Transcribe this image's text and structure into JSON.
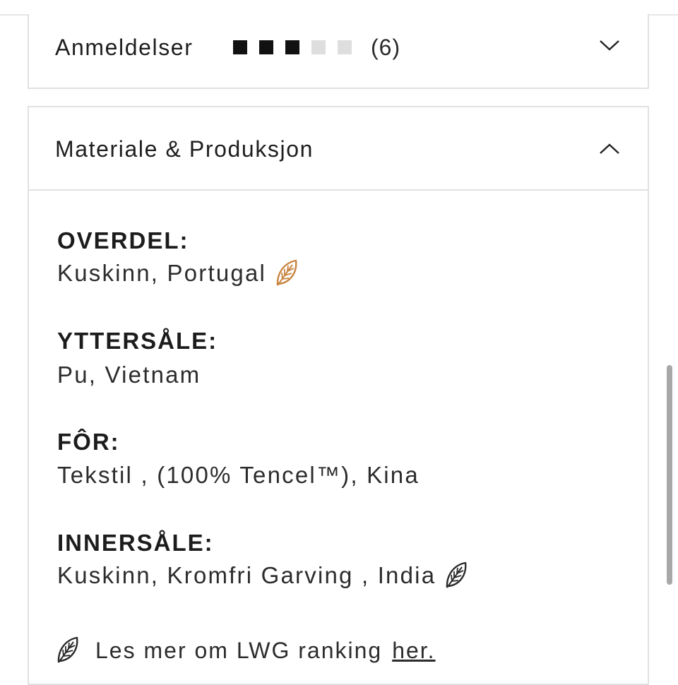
{
  "reviews": {
    "title": "Anmeldelser",
    "rating": 3,
    "rating_max": 5,
    "count": "(6)",
    "expanded": false
  },
  "materials": {
    "title": "Materiale & Produksjon",
    "expanded": true,
    "items": [
      {
        "label": "OVERDEL:",
        "value": "Kuskinn, Portugal",
        "leaf": "leaf-icon-orange"
      },
      {
        "label": "YTTERSÅLE:",
        "value": "Pu, Vietnam",
        "leaf": ""
      },
      {
        "label": "FÔR:",
        "value": "Tekstil , (100% Tencel™), Kina",
        "leaf": ""
      },
      {
        "label": "INNERSÅLE:",
        "value": "Kuskinn, Kromfri Garving , India",
        "leaf": "leaf-icon-black"
      }
    ],
    "footer_text": "Les mer om LWG ranking",
    "footer_link": "her."
  },
  "colors": {
    "leaf_orange": "#c8843f",
    "leaf_dark": "#2a2a2a",
    "rating_filled": "#111111",
    "rating_empty": "#dedede"
  }
}
